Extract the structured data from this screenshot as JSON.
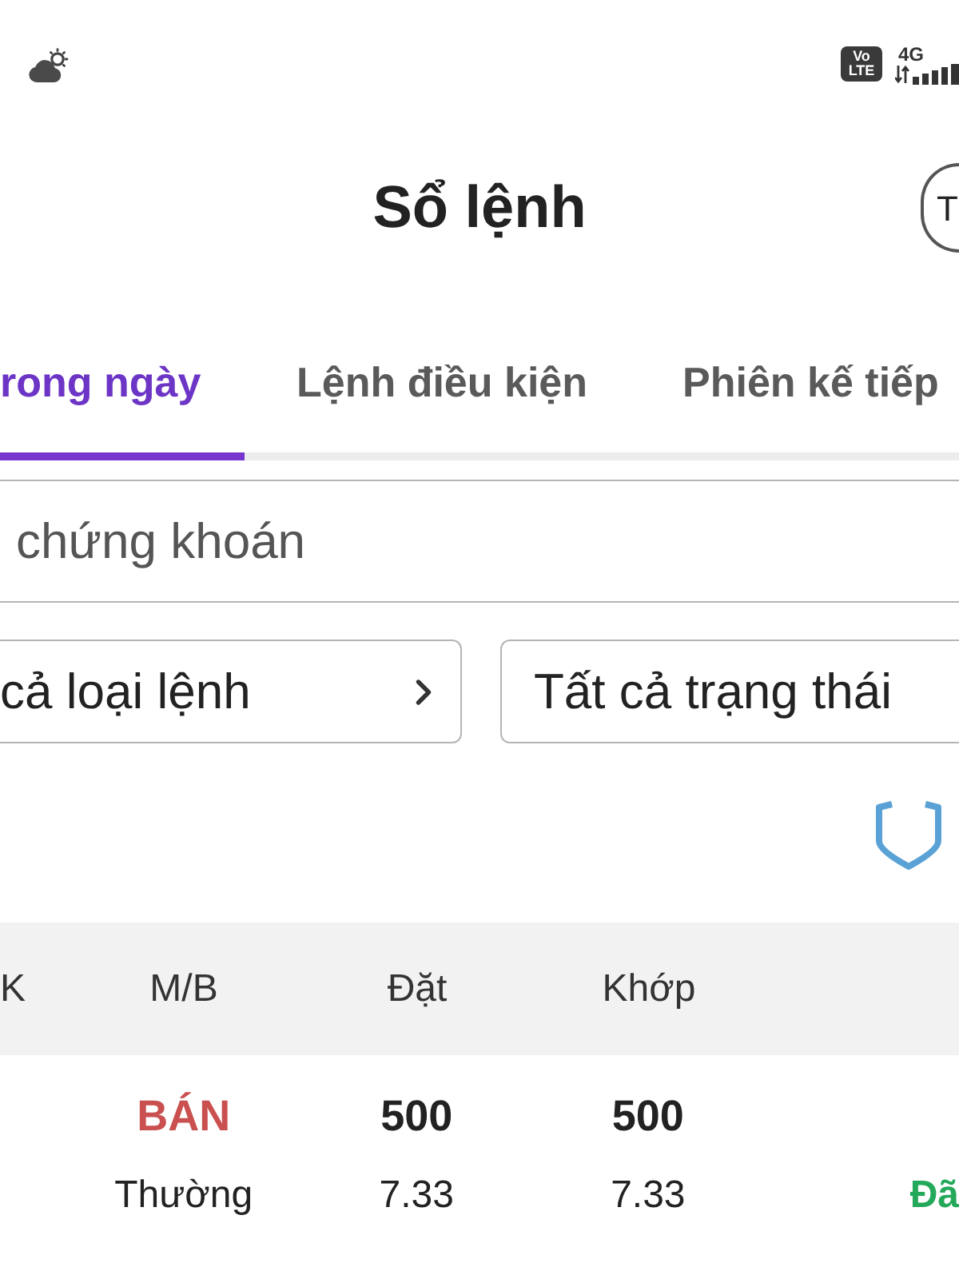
{
  "status_bar": {
    "volte_label": "Vo LTE",
    "network": "4G"
  },
  "header": {
    "title": "Sổ lệnh",
    "avatar_letter": "T"
  },
  "tabs": [
    {
      "label": "rong ngày",
      "selected": true
    },
    {
      "label": "Lệnh điều kiện",
      "selected": false
    },
    {
      "label": "Phiên kế tiếp",
      "selected": false
    }
  ],
  "search": {
    "placeholder": "chứng khoán"
  },
  "filters": [
    {
      "value": "cả loại lệnh",
      "kind": "chevron"
    },
    {
      "value": "Tất cả trạng thái",
      "kind": "plain"
    }
  ],
  "table": {
    "columns": [
      "K",
      "M/B",
      "Đặt",
      "Khớp"
    ],
    "rows": [
      {
        "side": {
          "text": "BÁN",
          "color": "#c9504f"
        },
        "order_type": "Thường",
        "order_qty": "500",
        "order_price": "7.33",
        "matched_qty": "500",
        "matched_price": "7.33",
        "status": {
          "text": "Đã",
          "color": "#24a85a"
        }
      }
    ]
  }
}
